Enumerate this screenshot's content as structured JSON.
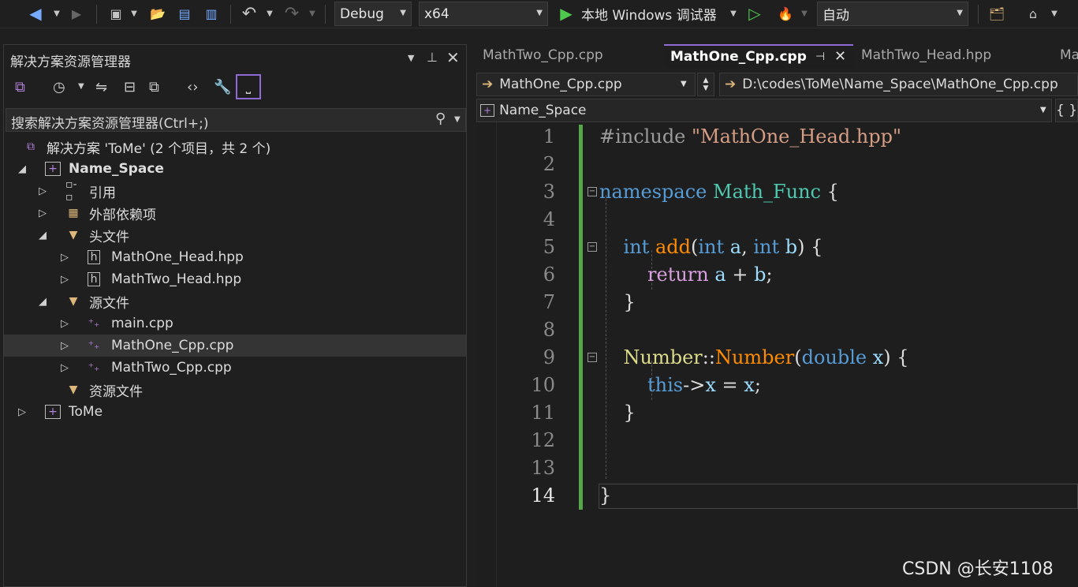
{
  "toolbar": {
    "config": "Debug",
    "platform": "x64",
    "run_label": "本地 Windows 调试器",
    "auto": "自动",
    "colors": {
      "run_green": "#4ec94e",
      "accent": "#8f6bd6"
    }
  },
  "solution_explorer": {
    "title": "解决方案资源管理器",
    "search_placeholder": "搜索解决方案资源管理器(Ctrl+;)",
    "solution": "解决方案 'ToMe' (2 个项目，共 2 个)",
    "items": [
      {
        "label": "Name_Space",
        "icon": "project-icon"
      },
      {
        "label": "引用",
        "icon": "references-icon"
      },
      {
        "label": "外部依赖项",
        "icon": "external-deps-icon"
      },
      {
        "label": "头文件",
        "icon": "filter-folder-icon"
      },
      {
        "label": "MathOne_Head.hpp",
        "icon": "header-file-icon"
      },
      {
        "label": "MathTwo_Head.hpp",
        "icon": "header-file-icon"
      },
      {
        "label": "源文件",
        "icon": "filter-folder-icon"
      },
      {
        "label": "main.cpp",
        "icon": "cpp-file-icon"
      },
      {
        "label": "MathOne_Cpp.cpp",
        "icon": "cpp-file-icon"
      },
      {
        "label": "MathTwo_Cpp.cpp",
        "icon": "cpp-file-icon"
      },
      {
        "label": "资源文件",
        "icon": "filter-folder-icon"
      },
      {
        "label": "ToMe",
        "icon": "project-icon"
      }
    ]
  },
  "editor": {
    "tabs": [
      "MathTwo_Cpp.cpp",
      "MathOne_Cpp.cpp",
      "MathTwo_Head.hpp",
      "Ma"
    ],
    "nav_file": "MathOne_Cpp.cpp",
    "nav_path": "D:\\codes\\ToMe\\Name_Space\\MathOne_Cpp.cpp",
    "nav_scope": "Name_Space",
    "braces": "{ }",
    "line_numbers": [
      "1",
      "2",
      "3",
      "4",
      "5",
      "6",
      "7",
      "8",
      "9",
      "10",
      "11",
      "12",
      "13",
      "14"
    ]
  },
  "watermark": "CSDN @长安1108"
}
